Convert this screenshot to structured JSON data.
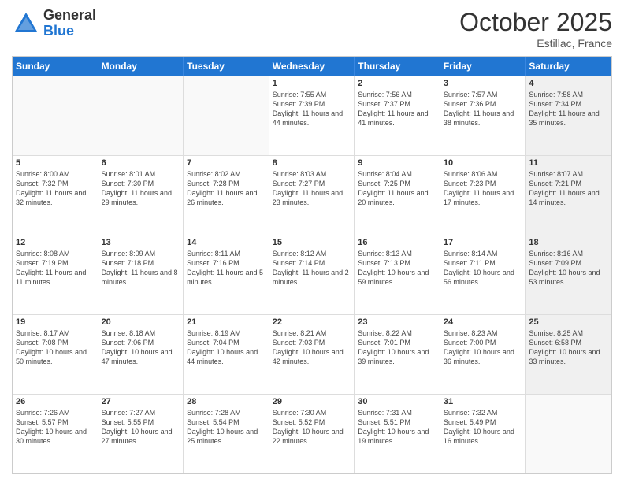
{
  "header": {
    "logo_general": "General",
    "logo_blue": "Blue",
    "month_title": "October 2025",
    "location": "Estillac, France"
  },
  "weekdays": [
    "Sunday",
    "Monday",
    "Tuesday",
    "Wednesday",
    "Thursday",
    "Friday",
    "Saturday"
  ],
  "weeks": [
    [
      {
        "day": "",
        "info": "",
        "shaded": false,
        "empty": true
      },
      {
        "day": "",
        "info": "",
        "shaded": false,
        "empty": true
      },
      {
        "day": "",
        "info": "",
        "shaded": false,
        "empty": true
      },
      {
        "day": "1",
        "info": "Sunrise: 7:55 AM\nSunset: 7:39 PM\nDaylight: 11 hours and 44 minutes.",
        "shaded": false,
        "empty": false
      },
      {
        "day": "2",
        "info": "Sunrise: 7:56 AM\nSunset: 7:37 PM\nDaylight: 11 hours and 41 minutes.",
        "shaded": false,
        "empty": false
      },
      {
        "day": "3",
        "info": "Sunrise: 7:57 AM\nSunset: 7:36 PM\nDaylight: 11 hours and 38 minutes.",
        "shaded": false,
        "empty": false
      },
      {
        "day": "4",
        "info": "Sunrise: 7:58 AM\nSunset: 7:34 PM\nDaylight: 11 hours and 35 minutes.",
        "shaded": true,
        "empty": false
      }
    ],
    [
      {
        "day": "5",
        "info": "Sunrise: 8:00 AM\nSunset: 7:32 PM\nDaylight: 11 hours and 32 minutes.",
        "shaded": false,
        "empty": false
      },
      {
        "day": "6",
        "info": "Sunrise: 8:01 AM\nSunset: 7:30 PM\nDaylight: 11 hours and 29 minutes.",
        "shaded": false,
        "empty": false
      },
      {
        "day": "7",
        "info": "Sunrise: 8:02 AM\nSunset: 7:28 PM\nDaylight: 11 hours and 26 minutes.",
        "shaded": false,
        "empty": false
      },
      {
        "day": "8",
        "info": "Sunrise: 8:03 AM\nSunset: 7:27 PM\nDaylight: 11 hours and 23 minutes.",
        "shaded": false,
        "empty": false
      },
      {
        "day": "9",
        "info": "Sunrise: 8:04 AM\nSunset: 7:25 PM\nDaylight: 11 hours and 20 minutes.",
        "shaded": false,
        "empty": false
      },
      {
        "day": "10",
        "info": "Sunrise: 8:06 AM\nSunset: 7:23 PM\nDaylight: 11 hours and 17 minutes.",
        "shaded": false,
        "empty": false
      },
      {
        "day": "11",
        "info": "Sunrise: 8:07 AM\nSunset: 7:21 PM\nDaylight: 11 hours and 14 minutes.",
        "shaded": true,
        "empty": false
      }
    ],
    [
      {
        "day": "12",
        "info": "Sunrise: 8:08 AM\nSunset: 7:19 PM\nDaylight: 11 hours and 11 minutes.",
        "shaded": false,
        "empty": false
      },
      {
        "day": "13",
        "info": "Sunrise: 8:09 AM\nSunset: 7:18 PM\nDaylight: 11 hours and 8 minutes.",
        "shaded": false,
        "empty": false
      },
      {
        "day": "14",
        "info": "Sunrise: 8:11 AM\nSunset: 7:16 PM\nDaylight: 11 hours and 5 minutes.",
        "shaded": false,
        "empty": false
      },
      {
        "day": "15",
        "info": "Sunrise: 8:12 AM\nSunset: 7:14 PM\nDaylight: 11 hours and 2 minutes.",
        "shaded": false,
        "empty": false
      },
      {
        "day": "16",
        "info": "Sunrise: 8:13 AM\nSunset: 7:13 PM\nDaylight: 10 hours and 59 minutes.",
        "shaded": false,
        "empty": false
      },
      {
        "day": "17",
        "info": "Sunrise: 8:14 AM\nSunset: 7:11 PM\nDaylight: 10 hours and 56 minutes.",
        "shaded": false,
        "empty": false
      },
      {
        "day": "18",
        "info": "Sunrise: 8:16 AM\nSunset: 7:09 PM\nDaylight: 10 hours and 53 minutes.",
        "shaded": true,
        "empty": false
      }
    ],
    [
      {
        "day": "19",
        "info": "Sunrise: 8:17 AM\nSunset: 7:08 PM\nDaylight: 10 hours and 50 minutes.",
        "shaded": false,
        "empty": false
      },
      {
        "day": "20",
        "info": "Sunrise: 8:18 AM\nSunset: 7:06 PM\nDaylight: 10 hours and 47 minutes.",
        "shaded": false,
        "empty": false
      },
      {
        "day": "21",
        "info": "Sunrise: 8:19 AM\nSunset: 7:04 PM\nDaylight: 10 hours and 44 minutes.",
        "shaded": false,
        "empty": false
      },
      {
        "day": "22",
        "info": "Sunrise: 8:21 AM\nSunset: 7:03 PM\nDaylight: 10 hours and 42 minutes.",
        "shaded": false,
        "empty": false
      },
      {
        "day": "23",
        "info": "Sunrise: 8:22 AM\nSunset: 7:01 PM\nDaylight: 10 hours and 39 minutes.",
        "shaded": false,
        "empty": false
      },
      {
        "day": "24",
        "info": "Sunrise: 8:23 AM\nSunset: 7:00 PM\nDaylight: 10 hours and 36 minutes.",
        "shaded": false,
        "empty": false
      },
      {
        "day": "25",
        "info": "Sunrise: 8:25 AM\nSunset: 6:58 PM\nDaylight: 10 hours and 33 minutes.",
        "shaded": true,
        "empty": false
      }
    ],
    [
      {
        "day": "26",
        "info": "Sunrise: 7:26 AM\nSunset: 5:57 PM\nDaylight: 10 hours and 30 minutes.",
        "shaded": false,
        "empty": false
      },
      {
        "day": "27",
        "info": "Sunrise: 7:27 AM\nSunset: 5:55 PM\nDaylight: 10 hours and 27 minutes.",
        "shaded": false,
        "empty": false
      },
      {
        "day": "28",
        "info": "Sunrise: 7:28 AM\nSunset: 5:54 PM\nDaylight: 10 hours and 25 minutes.",
        "shaded": false,
        "empty": false
      },
      {
        "day": "29",
        "info": "Sunrise: 7:30 AM\nSunset: 5:52 PM\nDaylight: 10 hours and 22 minutes.",
        "shaded": false,
        "empty": false
      },
      {
        "day": "30",
        "info": "Sunrise: 7:31 AM\nSunset: 5:51 PM\nDaylight: 10 hours and 19 minutes.",
        "shaded": false,
        "empty": false
      },
      {
        "day": "31",
        "info": "Sunrise: 7:32 AM\nSunset: 5:49 PM\nDaylight: 10 hours and 16 minutes.",
        "shaded": false,
        "empty": false
      },
      {
        "day": "",
        "info": "",
        "shaded": true,
        "empty": true
      }
    ]
  ]
}
